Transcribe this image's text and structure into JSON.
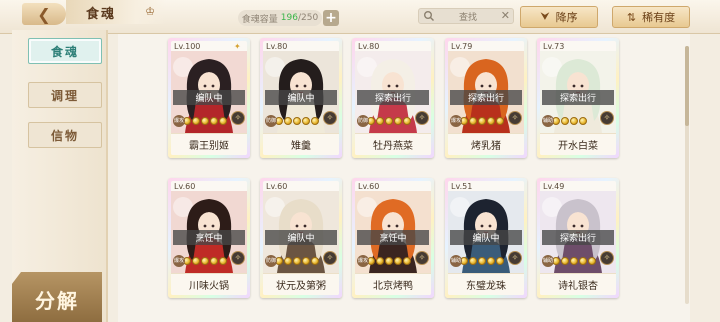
{
  "header": {
    "title": "食魂",
    "capacity_label": "食魂容量",
    "capacity_current": "196",
    "capacity_max": "/250",
    "search_placeholder": "查找",
    "sort_desc_label": "降序",
    "sort_rarity_label": "稀有度"
  },
  "sidebar": {
    "tabs": [
      {
        "label": "食魂",
        "active": true
      },
      {
        "label": "调理",
        "active": false
      },
      {
        "label": "信物",
        "active": false
      }
    ],
    "decompose_label": "分解"
  },
  "cards": [
    {
      "level": "Lv.100",
      "status": "编队中",
      "name": "霸王别姬",
      "stars": 5,
      "type": "爆攻",
      "hair": "#2b2022",
      "robe": "#b3262a",
      "bg": "#f2d9d3"
    },
    {
      "level": "Lv.80",
      "status": "编队中",
      "name": "雉羹",
      "stars": 5,
      "type": "防御",
      "hair": "#241d1c",
      "robe": "#f0ead9",
      "bg": "#ece5da"
    },
    {
      "level": "Lv.80",
      "status": "探索出行",
      "name": "牡丹燕菜",
      "stars": 5,
      "type": "防御",
      "hair": "#f4efe6",
      "robe": "#c53a4a",
      "bg": "#f4ecec"
    },
    {
      "level": "Lv.79",
      "status": "探索出行",
      "name": "烤乳猪",
      "stars": 5,
      "type": "爆攻",
      "hair": "#d9651f",
      "robe": "#b8311c",
      "bg": "#f2e0cf"
    },
    {
      "level": "Lv.73",
      "status": "探索出行",
      "name": "开水白菜",
      "stars": 4,
      "type": "辅助",
      "hair": "#dce9d6",
      "robe": "#efeadc",
      "bg": "#f3f3ea"
    },
    {
      "level": "Lv.60",
      "status": "烹饪中",
      "name": "川味火锅",
      "stars": 5,
      "type": "爆攻",
      "hair": "#2d1c18",
      "robe": "#bf2b26",
      "bg": "#f1d8d2"
    },
    {
      "level": "Lv.60",
      "status": "编队中",
      "name": "状元及第粥",
      "stars": 5,
      "type": "防御",
      "hair": "#e8ddc9",
      "robe": "#6b5542",
      "bg": "#efe7dc"
    },
    {
      "level": "Lv.60",
      "status": "烹饪中",
      "name": "北京烤鸭",
      "stars": 5,
      "type": "爆攻",
      "hair": "#e06b24",
      "robe": "#3b2520",
      "bg": "#f4e0cf"
    },
    {
      "level": "Lv.51",
      "status": "编队中",
      "name": "东璧龙珠",
      "stars": 5,
      "type": "辅助",
      "hair": "#1d2330",
      "robe": "#3a5c7a",
      "bg": "#e5e9ee"
    },
    {
      "level": "Lv.49",
      "status": "探索出行",
      "name": "诗礼银杏",
      "stars": 5,
      "type": "辅助",
      "hair": "#c9c2cc",
      "robe": "#6e4d6a",
      "bg": "#eee7ef"
    }
  ]
}
